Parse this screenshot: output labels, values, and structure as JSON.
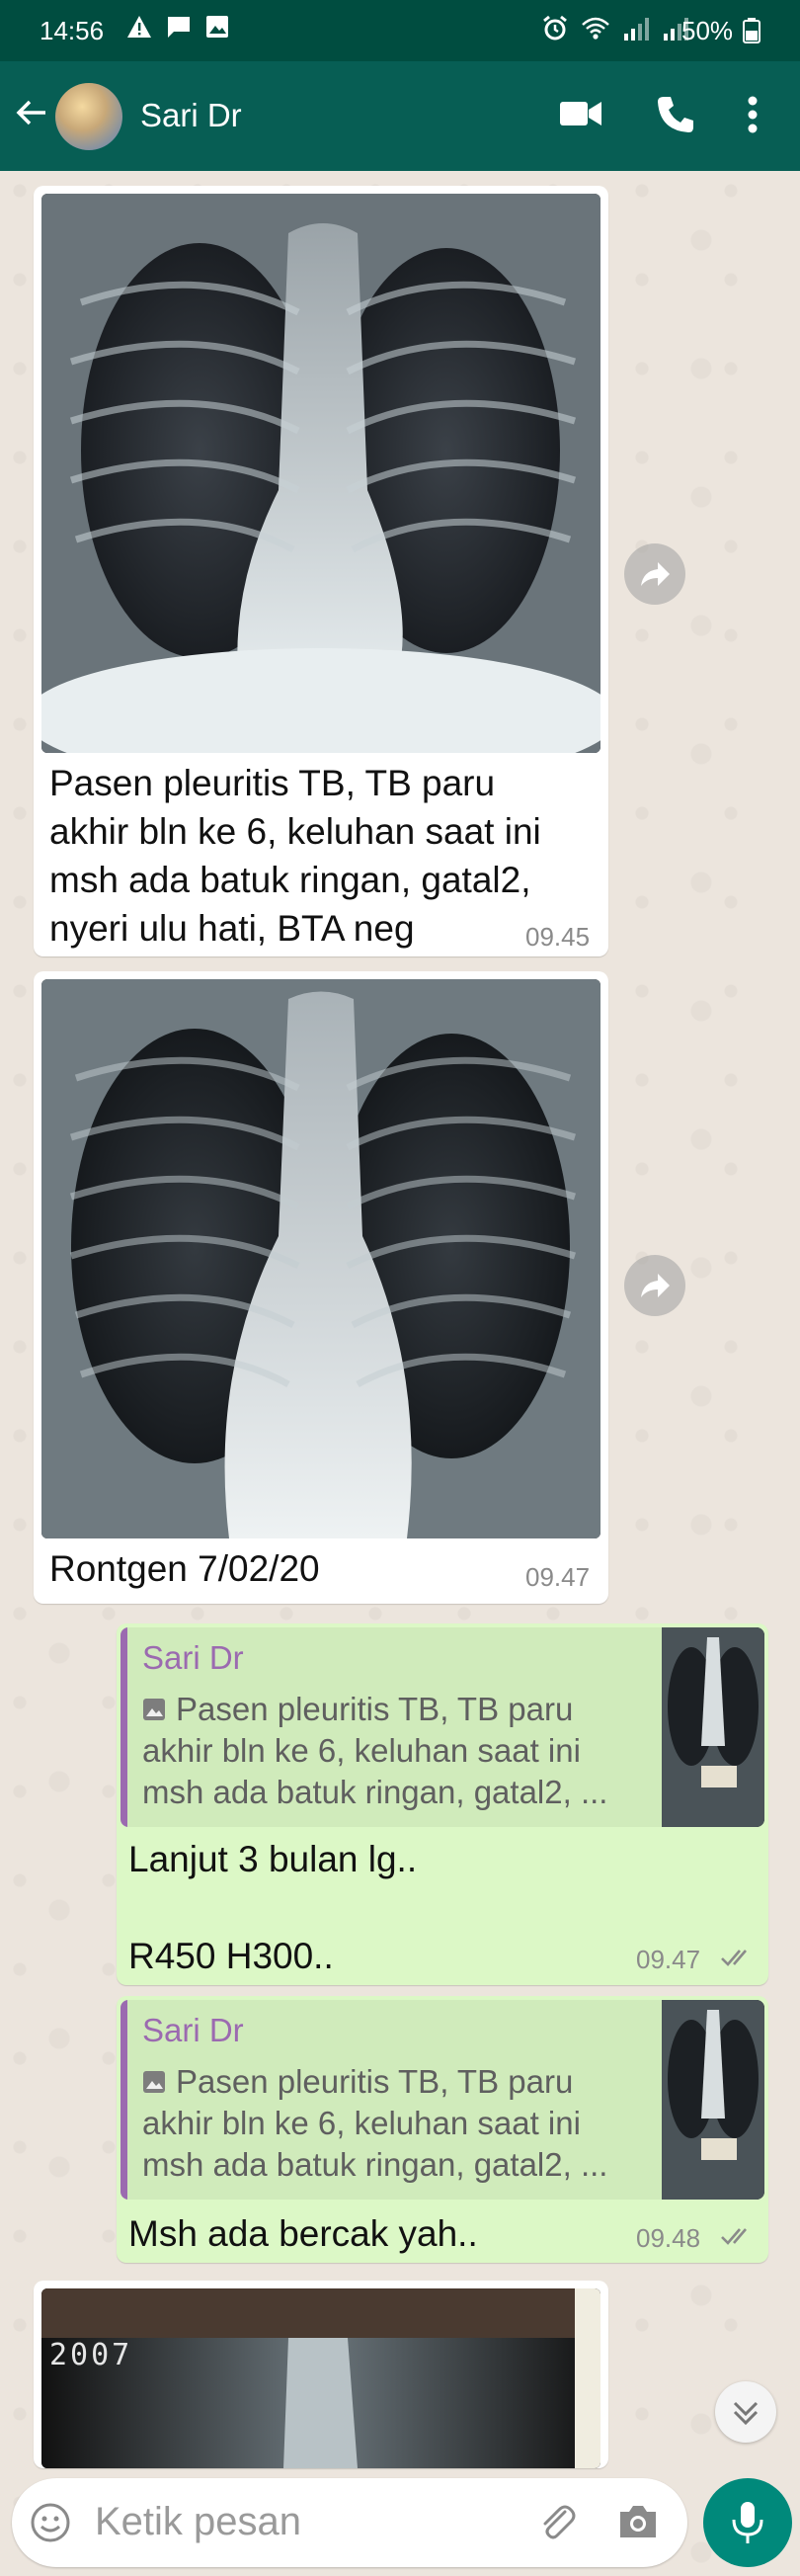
{
  "status_bar": {
    "time": "14:56",
    "battery": "50%"
  },
  "header": {
    "contact_name": "Sari Dr"
  },
  "messages": [
    {
      "caption_lines": [
        "Pasen pleuritis TB, TB paru",
        "akhir bln ke 6, keluhan saat ini",
        "msh ada batuk ringan, gatal2,",
        "nyeri ulu hati, BTA neg"
      ],
      "time": "09.45"
    },
    {
      "caption": "Rontgen 7/02/20",
      "time": "09.47"
    },
    {
      "quote_name": "Sari Dr",
      "quote_lines": [
        "Pasen pleuritis TB, TB paru",
        "akhir bln ke 6, keluhan saat ini",
        "msh ada batuk ringan, gatal2, ..."
      ],
      "text_line1": "Lanjut 3 bulan lg..",
      "text_line2": "R450 H300..",
      "time": "09.47"
    },
    {
      "quote_name": "Sari Dr",
      "quote_lines": [
        "Pasen pleuritis TB, TB paru",
        "akhir bln ke 6, keluhan saat ini",
        "msh ada batuk ringan, gatal2, ..."
      ],
      "text": "Msh ada bercak yah..",
      "time": "09.48"
    }
  ],
  "last_image_label": "2007",
  "composer": {
    "placeholder": "Ketik pesan"
  },
  "colors": {
    "header": "#075e54",
    "status_bar": "#004d40",
    "outgoing_bubble": "#dcf8c6",
    "quote_accent": "#9b6ab0",
    "read_ticks": "#8a8a8a",
    "mic_button": "#00897b"
  }
}
